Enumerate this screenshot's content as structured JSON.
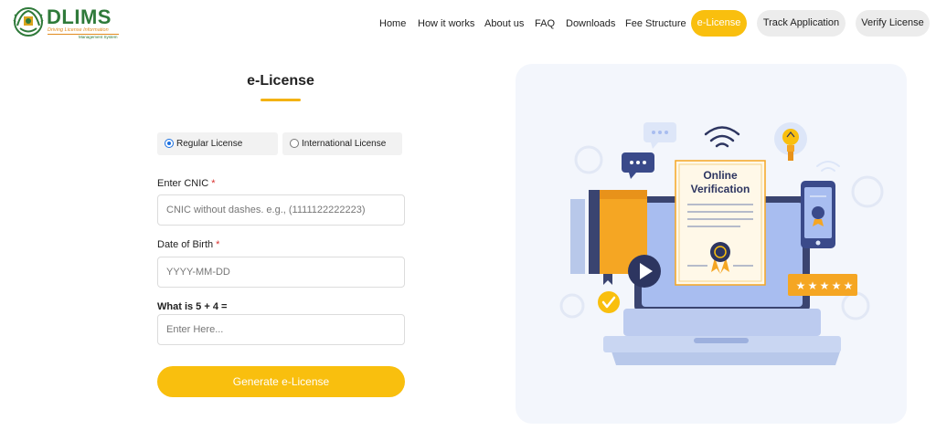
{
  "header": {
    "logo": {
      "title": "DLIMS",
      "subtitle": "Driving License Information",
      "subtitle2": "Management System"
    },
    "nav": [
      {
        "label": "Home"
      },
      {
        "label": "How it works"
      },
      {
        "label": "About us"
      },
      {
        "label": "FAQ"
      },
      {
        "label": "Downloads"
      },
      {
        "label": "Fee Structure"
      }
    ],
    "pills": [
      {
        "label": "e-License",
        "active": true
      },
      {
        "label": "Track Application",
        "active": false
      },
      {
        "label": "Verify License",
        "active": false
      }
    ]
  },
  "form": {
    "title": "e-License",
    "license_types": [
      {
        "label": "Regular License",
        "selected": true
      },
      {
        "label": "International License",
        "selected": false
      }
    ],
    "cnic": {
      "label": "Enter CNIC",
      "required_mark": "*",
      "placeholder": "CNIC without dashes. e.g., (1111122222223)"
    },
    "dob": {
      "label": "Date of Birth",
      "required_mark": "*",
      "placeholder": "YYYY-MM-DD"
    },
    "captcha": {
      "label": "What is 5 + 4 =",
      "placeholder": "Enter Here..."
    },
    "submit_label": "Generate e-License"
  },
  "illustration": {
    "certificate_line1": "Online",
    "certificate_line2": "Verification"
  },
  "colors": {
    "accent": "#f9bf0e",
    "brand_green": "#2f7a3a",
    "required": "#d9322f",
    "illustration_bg": "#f3f6fc",
    "navy": "#2d3560"
  }
}
